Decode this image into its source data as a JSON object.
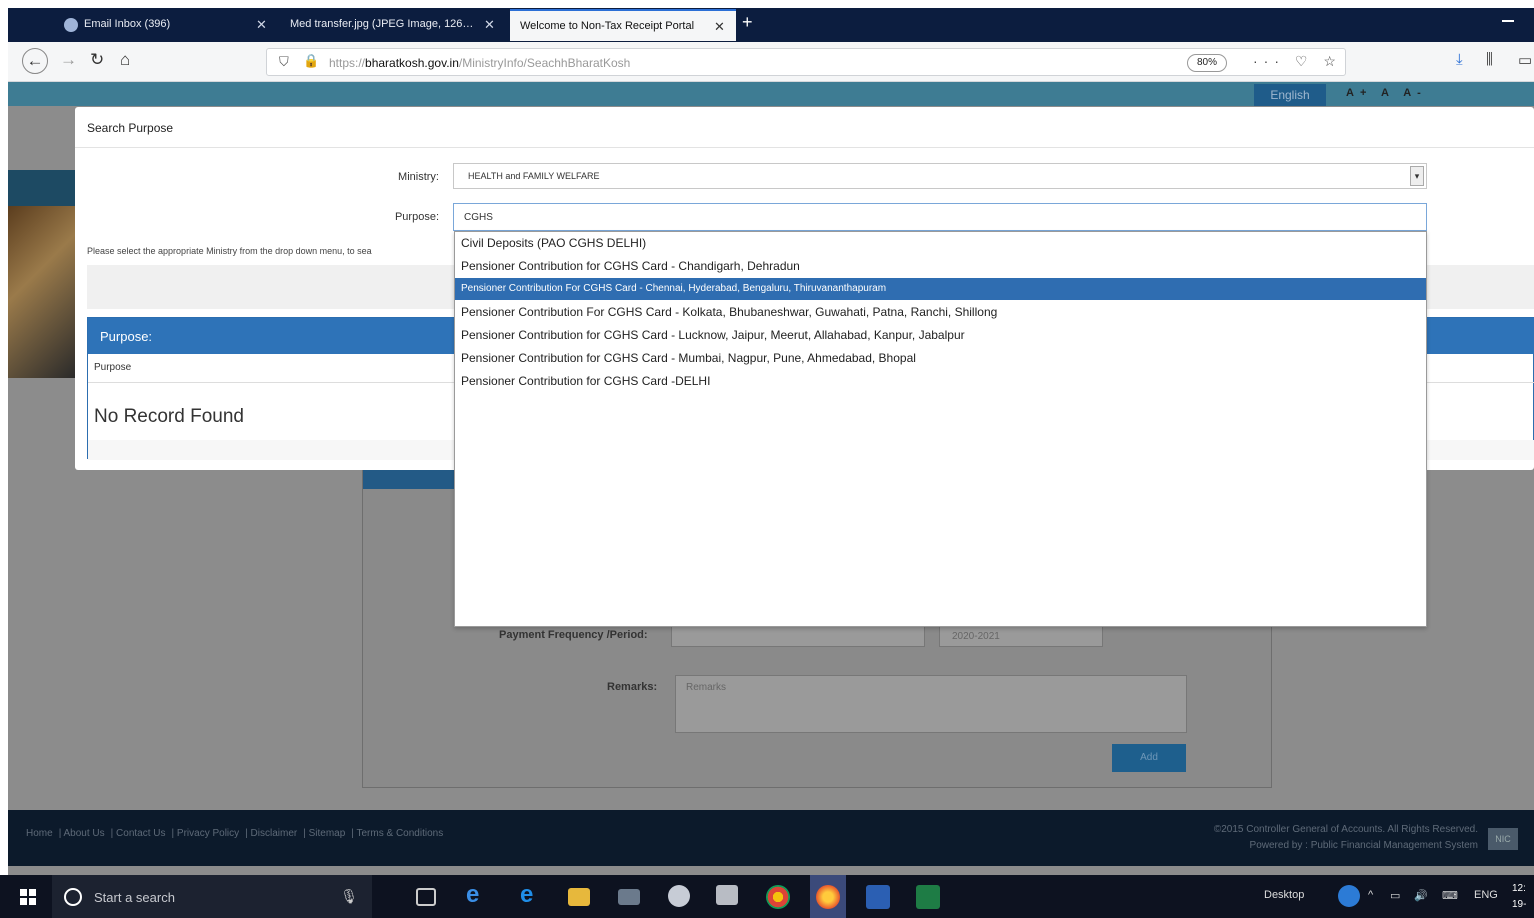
{
  "browser": {
    "tabs": [
      {
        "label": "Email Inbox (396)",
        "active": false
      },
      {
        "label": "Med transfer.jpg (JPEG Image, 126…",
        "active": false
      },
      {
        "label": "Welcome to Non-Tax Receipt Portal",
        "active": true
      }
    ],
    "new_tab": "+",
    "url_prefix": "https://",
    "url_domain": "bharatkosh.gov.in",
    "url_path": "/MinistryInfo/SeachhBharatKosh",
    "zoom": "80%",
    "url_actions": "··· ♡ ☆"
  },
  "site": {
    "language": "English",
    "font_sizes": "A+ A A-",
    "form": {
      "payment_label": "Payment Frequency /Period:",
      "period_value": "2020-2021",
      "remarks_label": "Remarks:",
      "remarks_placeholder": "Remarks",
      "add_button": "Add"
    },
    "footer": {
      "links": [
        "Home",
        "About Us",
        "Contact Us",
        "Privacy Policy",
        "Disclaimer",
        "Sitemap",
        "Terms & Conditions"
      ],
      "copyright": "©2015 Controller General of Accounts. All Rights Reserved.",
      "powered": "Powered by : Public Financial Management System",
      "badge": "NIC"
    }
  },
  "modal": {
    "title": "Search Purpose",
    "ministry_label": "Ministry:",
    "ministry_value": "HEALTH and FAMILY WELFARE",
    "purpose_label": "Purpose:",
    "purpose_value": "CGHS",
    "help_text": "Please select the appropriate Ministry from the drop down menu, to sea",
    "panel_title": "Purpose:",
    "column_header": "Purpose",
    "empty_message": "No Record Found"
  },
  "dropdown": {
    "items": [
      "Civil Deposits (PAO CGHS DELHI)",
      "Pensioner Contribution for CGHS Card - Chandigarh, Dehradun",
      "Pensioner Contribution For CGHS Card - Chennai, Hyderabad, Bengaluru, Thiruvananthapuram",
      "Pensioner Contribution For CGHS Card - Kolkata, Bhubaneshwar, Guwahati, Patna, Ranchi, Shillong",
      "Pensioner Contribution for CGHS Card - Lucknow, Jaipur, Meerut, Allahabad, Kanpur, Jabalpur",
      "Pensioner Contribution for CGHS Card - Mumbai, Nagpur, Pune, Ahmedabad, Bhopal",
      "Pensioner Contribution for CGHS Card -DELHI"
    ],
    "selected_index": 2
  },
  "taskbar": {
    "search_placeholder": "Start a search",
    "desktop_label": "Desktop",
    "lang": "ENG",
    "clock_time": "12:",
    "clock_date": "19-"
  },
  "colors": {
    "accent": "#2e73b8",
    "selection": "#2f6db1",
    "tabbar": "#0c1d3f"
  }
}
